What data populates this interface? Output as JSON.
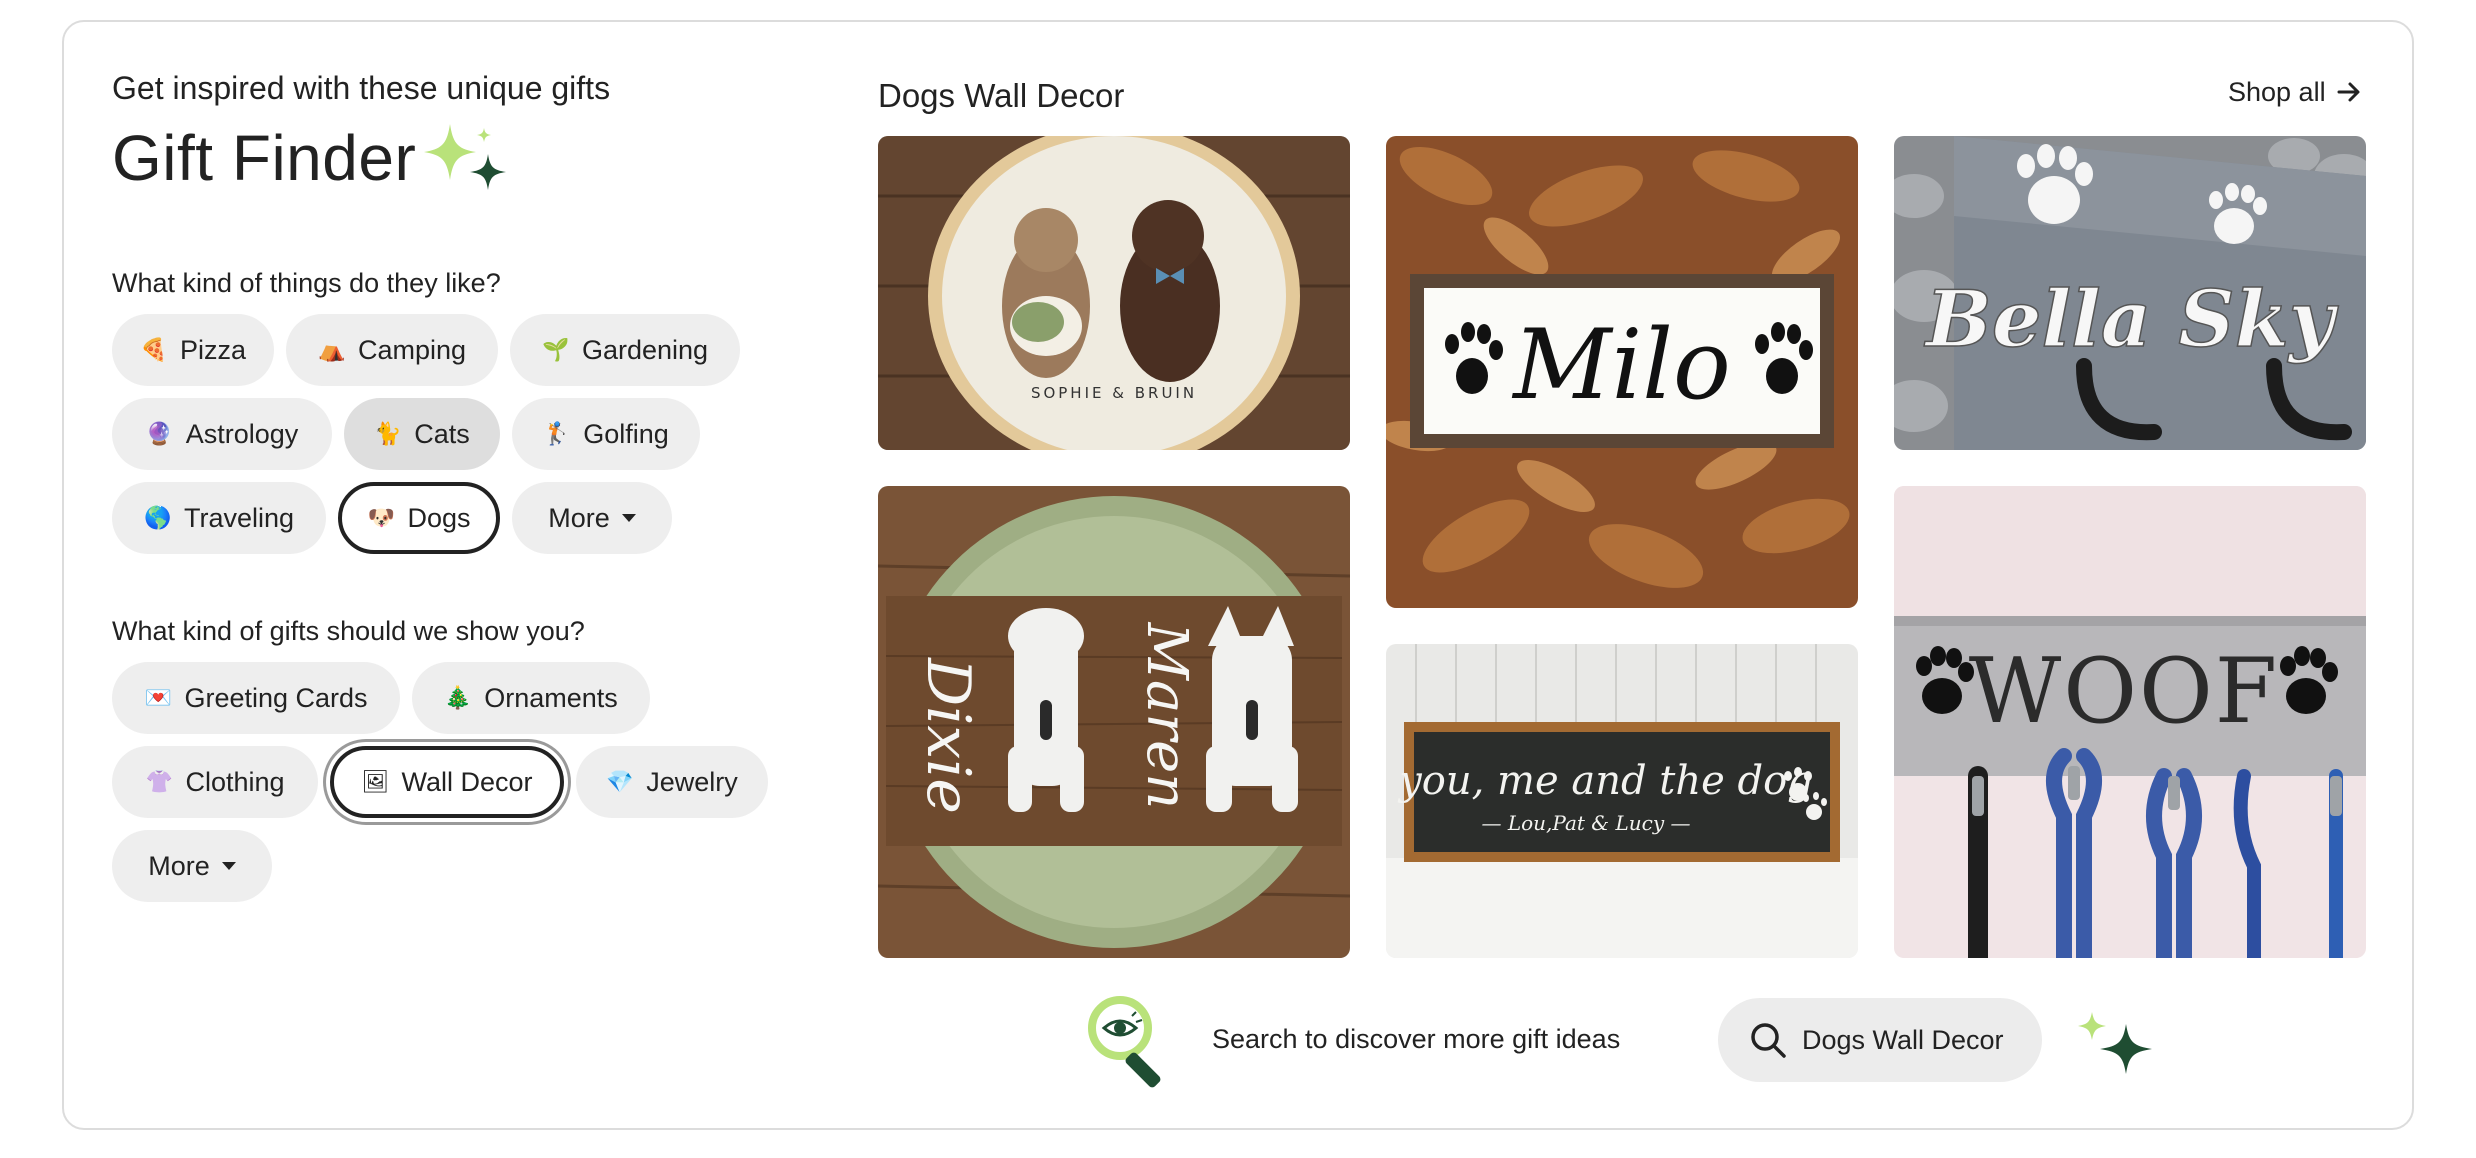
{
  "header": {
    "subtitle": "Get inspired with these unique gifts",
    "title": "Gift Finder"
  },
  "interests": {
    "question": "What kind of things do they like?",
    "chips": [
      {
        "emoji": "🍕",
        "label": "Pizza",
        "state": "default"
      },
      {
        "emoji": "⛺",
        "label": "Camping",
        "state": "default"
      },
      {
        "emoji": "🌱",
        "label": "Gardening",
        "state": "default"
      },
      {
        "emoji": "🔮",
        "label": "Astrology",
        "state": "default"
      },
      {
        "emoji": "🐈",
        "label": "Cats",
        "state": "hover"
      },
      {
        "emoji": "🏌",
        "label": "Golfing",
        "state": "default"
      },
      {
        "emoji": "🌎",
        "label": "Traveling",
        "state": "default"
      },
      {
        "emoji": "🐶",
        "label": "Dogs",
        "state": "selected"
      }
    ],
    "more_label": "More"
  },
  "gift_types": {
    "question": "What kind of gifts should we show you?",
    "chips": [
      {
        "emoji": "💌",
        "label": "Greeting Cards",
        "state": "default"
      },
      {
        "emoji": "🎄",
        "label": "Ornaments",
        "state": "default"
      },
      {
        "emoji": "👚",
        "label": "Clothing",
        "state": "default"
      },
      {
        "emoji": "🖼",
        "label": "Wall Decor",
        "state": "selected"
      },
      {
        "emoji": "💎",
        "label": "Jewelry",
        "state": "default"
      }
    ],
    "more_label": "More"
  },
  "results": {
    "title": "Dogs Wall Decor",
    "shop_all_label": "Shop all",
    "images": [
      {
        "name": "embroidery-hoop",
        "caption": "SOPHIE & BRUIN"
      },
      {
        "name": "milo-sign",
        "caption": "Milo"
      },
      {
        "name": "bella-sky-hooks",
        "caption": "Bella Sky"
      },
      {
        "name": "dixie-maren-hooks",
        "caption_left": "Dixie",
        "caption_right": "Maren"
      },
      {
        "name": "you-me-dog-sign",
        "caption": "you, me and the dog",
        "subcaption": "— Lou,Pat & Lucy —"
      },
      {
        "name": "woof-leash-holder",
        "caption": "WOOF"
      }
    ]
  },
  "footer": {
    "discover_text": "Search to discover more gift ideas",
    "search_query": "Dogs Wall Decor"
  },
  "colors": {
    "chip_bg": "#eeeeee",
    "selected_border": "#222222",
    "sparkle_light": "#b9e27a",
    "sparkle_dark": "#1f4d32"
  }
}
